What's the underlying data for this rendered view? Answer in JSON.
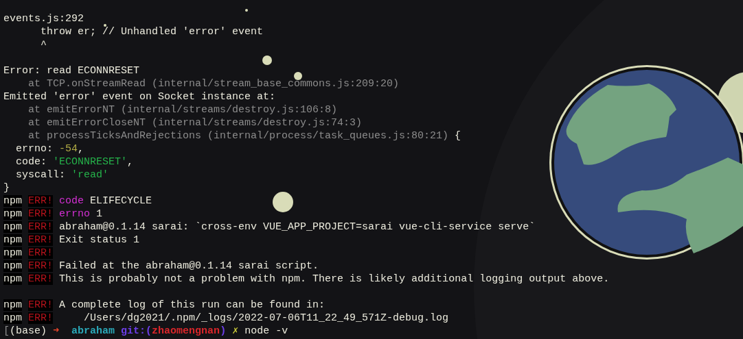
{
  "terminal": {
    "lines": [
      {
        "kind": "text",
        "segments": [
          {
            "kind": "plain",
            "text": "events.js:292"
          }
        ]
      },
      {
        "kind": "text",
        "segments": [
          {
            "kind": "plain",
            "text": "      throw er; // Unhandled 'error' event"
          }
        ]
      },
      {
        "kind": "text",
        "segments": [
          {
            "kind": "plain",
            "text": "      ^"
          }
        ]
      },
      {
        "kind": "blank"
      },
      {
        "kind": "text",
        "segments": [
          {
            "kind": "plain",
            "text": "Error: read ECONNRESET"
          }
        ]
      },
      {
        "kind": "text",
        "segments": [
          {
            "kind": "dim",
            "text": "    at TCP.onStreamRead (internal/stream_base_commons.js:209:20)"
          }
        ]
      },
      {
        "kind": "text",
        "segments": [
          {
            "kind": "plain",
            "text": "Emitted 'error' event on Socket instance at:"
          }
        ]
      },
      {
        "kind": "text",
        "segments": [
          {
            "kind": "dim",
            "text": "    at emitErrorNT (internal/streams/destroy.js:106:8)"
          }
        ]
      },
      {
        "kind": "text",
        "segments": [
          {
            "kind": "dim",
            "text": "    at emitErrorCloseNT (internal/streams/destroy.js:74:3)"
          }
        ]
      },
      {
        "kind": "text",
        "segments": [
          {
            "kind": "dim",
            "text": "    at processTicksAndRejections (internal/process/task_queues.js:80:21)"
          },
          {
            "kind": "plain",
            "text": " {"
          }
        ]
      },
      {
        "kind": "text",
        "segments": [
          {
            "kind": "plain",
            "text": "  errno: "
          },
          {
            "kind": "number",
            "text": "-54"
          },
          {
            "kind": "plain",
            "text": ","
          }
        ]
      },
      {
        "kind": "text",
        "segments": [
          {
            "kind": "plain",
            "text": "  code: "
          },
          {
            "kind": "string",
            "text": "'ECONNRESET'"
          },
          {
            "kind": "plain",
            "text": ","
          }
        ]
      },
      {
        "kind": "text",
        "segments": [
          {
            "kind": "plain",
            "text": "  syscall: "
          },
          {
            "kind": "string",
            "text": "'read'"
          }
        ]
      },
      {
        "kind": "text",
        "segments": [
          {
            "kind": "plain",
            "text": "}"
          }
        ]
      },
      {
        "kind": "text",
        "segments": [
          {
            "kind": "npm",
            "text": "npm"
          },
          {
            "kind": "err",
            "text": "ERR!"
          },
          {
            "kind": "keyword",
            "text": " code"
          },
          {
            "kind": "plain",
            "text": " ELIFECYCLE"
          }
        ]
      },
      {
        "kind": "text",
        "segments": [
          {
            "kind": "npm",
            "text": "npm"
          },
          {
            "kind": "err",
            "text": "ERR!"
          },
          {
            "kind": "keyword",
            "text": " errno"
          },
          {
            "kind": "plain",
            "text": " 1"
          }
        ]
      },
      {
        "kind": "text",
        "segments": [
          {
            "kind": "npm",
            "text": "npm"
          },
          {
            "kind": "err",
            "text": "ERR!"
          },
          {
            "kind": "plain",
            "text": " abraham@0.1.14 sarai: `cross-env VUE_APP_PROJECT=sarai vue-cli-service serve`"
          }
        ]
      },
      {
        "kind": "text",
        "segments": [
          {
            "kind": "npm",
            "text": "npm"
          },
          {
            "kind": "err",
            "text": "ERR!"
          },
          {
            "kind": "plain",
            "text": " Exit status 1"
          }
        ]
      },
      {
        "kind": "text",
        "segments": [
          {
            "kind": "npm",
            "text": "npm"
          },
          {
            "kind": "err",
            "text": "ERR!"
          }
        ]
      },
      {
        "kind": "text",
        "segments": [
          {
            "kind": "npm",
            "text": "npm"
          },
          {
            "kind": "err",
            "text": "ERR!"
          },
          {
            "kind": "plain",
            "text": " Failed at the abraham@0.1.14 sarai script."
          }
        ]
      },
      {
        "kind": "text",
        "segments": [
          {
            "kind": "npm",
            "text": "npm"
          },
          {
            "kind": "err",
            "text": "ERR!"
          },
          {
            "kind": "plain",
            "text": " This is probably not a problem with npm. There is likely additional logging output above."
          }
        ]
      },
      {
        "kind": "blank"
      },
      {
        "kind": "text",
        "segments": [
          {
            "kind": "npm",
            "text": "npm"
          },
          {
            "kind": "err",
            "text": "ERR!"
          },
          {
            "kind": "plain",
            "text": " A complete log of this run can be found in:"
          }
        ]
      },
      {
        "kind": "text",
        "segments": [
          {
            "kind": "npm",
            "text": "npm"
          },
          {
            "kind": "err",
            "text": "ERR!"
          },
          {
            "kind": "plain",
            "text": "     /Users/dg2021/.npm/_logs/2022-07-06T11_22_49_571Z-debug.log"
          }
        ]
      },
      {
        "kind": "text",
        "segments": [
          {
            "kind": "dim",
            "text": "["
          },
          {
            "kind": "plain",
            "text": "(base) "
          },
          {
            "kind": "arrow",
            "text": "➜"
          },
          {
            "kind": "dir",
            "text": "  abraham"
          },
          {
            "kind": "git",
            "text": " git:("
          },
          {
            "kind": "branch",
            "text": "zhaomengnan"
          },
          {
            "kind": "git",
            "text": ")"
          },
          {
            "kind": "dirty",
            "text": " ✗"
          },
          {
            "kind": "plain",
            "text": " node -v"
          }
        ]
      }
    ]
  }
}
